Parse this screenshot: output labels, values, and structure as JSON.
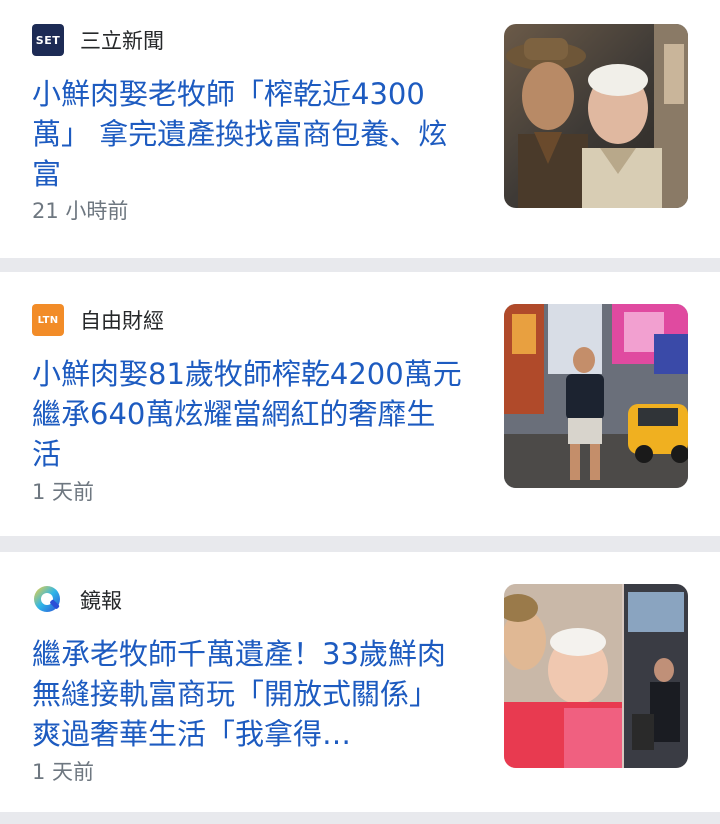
{
  "articles": [
    {
      "source": "三立新聞",
      "source_logo_text": "SET",
      "source_logo_color": "#1d2b55",
      "headline": "小鮮肉娶老牧師「榨乾近4300萬」 拿完遺產換找富商包養、炫富",
      "time": "21 小時前",
      "thumbnail": "two-men-selfie-photo"
    },
    {
      "source": "自由財經",
      "source_logo_text": "LTN",
      "source_logo_color": "#f28c28",
      "headline": "小鮮肉娶81歲牧師榨乾4200萬元 繼承640萬炫耀當網紅的奢靡生活",
      "time": "1 天前",
      "thumbnail": "man-times-square-photo"
    },
    {
      "source": "鏡報",
      "source_logo_text": "",
      "source_logo_color": "#3b8fd9",
      "headline": "繼承老牧師千萬遺產！33歲鮮肉無縫接軌富商玩「開放式關係」 爽過奢華生活「我拿得…",
      "time": "1 天前",
      "thumbnail": "selfie-collage-photo"
    }
  ],
  "colors": {
    "headline": "#1d5bc0",
    "source": "#26282a",
    "time": "#6e7780",
    "separator": "#e8e9ed"
  }
}
